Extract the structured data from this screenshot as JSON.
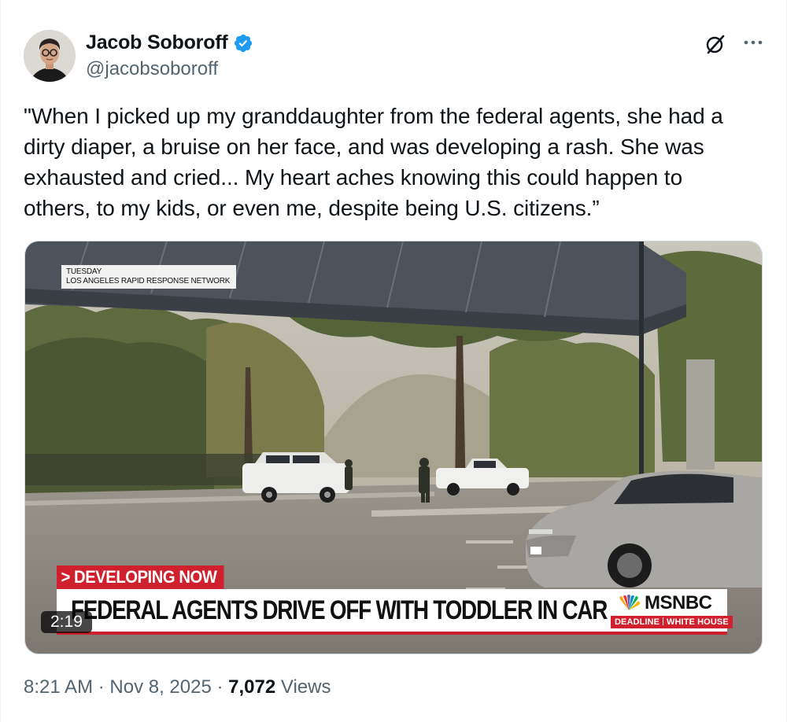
{
  "author": {
    "name": "Jacob Soboroff",
    "handle": "@jacobsoboroff",
    "verified": true,
    "verified_color": "#1d9bf0"
  },
  "tweet": {
    "text_lines": [
      "\"When I picked up my granddaughter from the federal agents, she had a",
      "dirty diaper, a bruise on her face, and was developing a rash. She was",
      "exhausted and cried... My heart aches knowing this could happen to",
      "others, to my kids, or even me, despite being U.S. citizens.”"
    ]
  },
  "media": {
    "type": "video",
    "duration": "2:19",
    "source_label_line1": "TUESDAY",
    "source_label_line2": "LOS ANGELES RAPID RESPONSE NETWORK",
    "badge": "> DEVELOPING NOW",
    "headline": "FEDERAL AGENTS DRIVE OFF WITH TODDLER IN CAR IN L.A.",
    "network": "MSNBC",
    "show_left": "DEADLINE",
    "show_right": "WHITE HOUSE",
    "accent_color": "#d0202e"
  },
  "footer": {
    "time": "8:21 AM",
    "separator": " · ",
    "date": "Nov 8, 2025",
    "views_count": "7,072",
    "views_label": "Views"
  },
  "icons": {
    "grok": "grok-icon",
    "more": "more-icon",
    "verified": "verified-badge-icon"
  }
}
